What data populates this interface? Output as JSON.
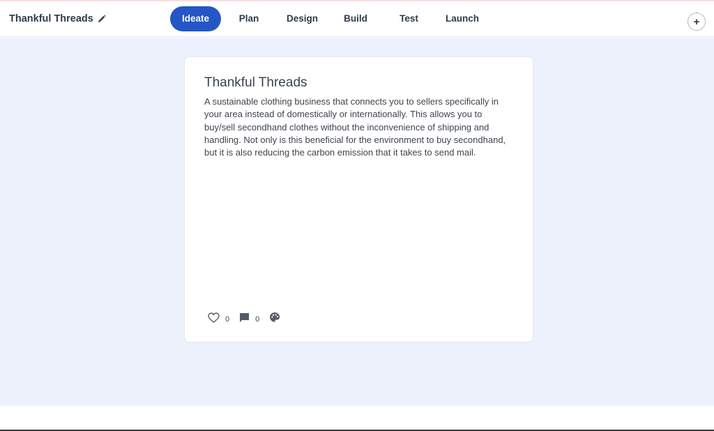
{
  "header": {
    "project_title": "Thankful Threads",
    "tabs": [
      {
        "label": "Ideate",
        "active": true
      },
      {
        "label": "Plan",
        "active": false
      },
      {
        "label": "Design",
        "active": false
      },
      {
        "label": "Build",
        "active": false
      },
      {
        "label": "Test",
        "active": false
      },
      {
        "label": "Launch",
        "active": false
      }
    ],
    "add_label": "+",
    "icons": {
      "edit": "pencil-icon",
      "add": "plus-icon"
    }
  },
  "card": {
    "title": "Thankful Threads",
    "body": "A sustainable clothing business that connects you to sellers specifically in your area instead of domestically or internationally. This allows you to buy/sell secondhand clothes without the inconvenience of shipping and handling. Not only is this beneficial for the environment to buy secondhand, but it is also reducing the carbon emission that it takes to send mail.",
    "likes": "0",
    "comments": "0",
    "icons": {
      "like": "heart-icon",
      "comment": "comment-icon",
      "theme": "palette-icon"
    }
  },
  "colors": {
    "accent": "#2457c5",
    "canvas_bg": "#edf1fc",
    "card_bg": "#ffffff",
    "text_dark": "#2f3b4a"
  }
}
